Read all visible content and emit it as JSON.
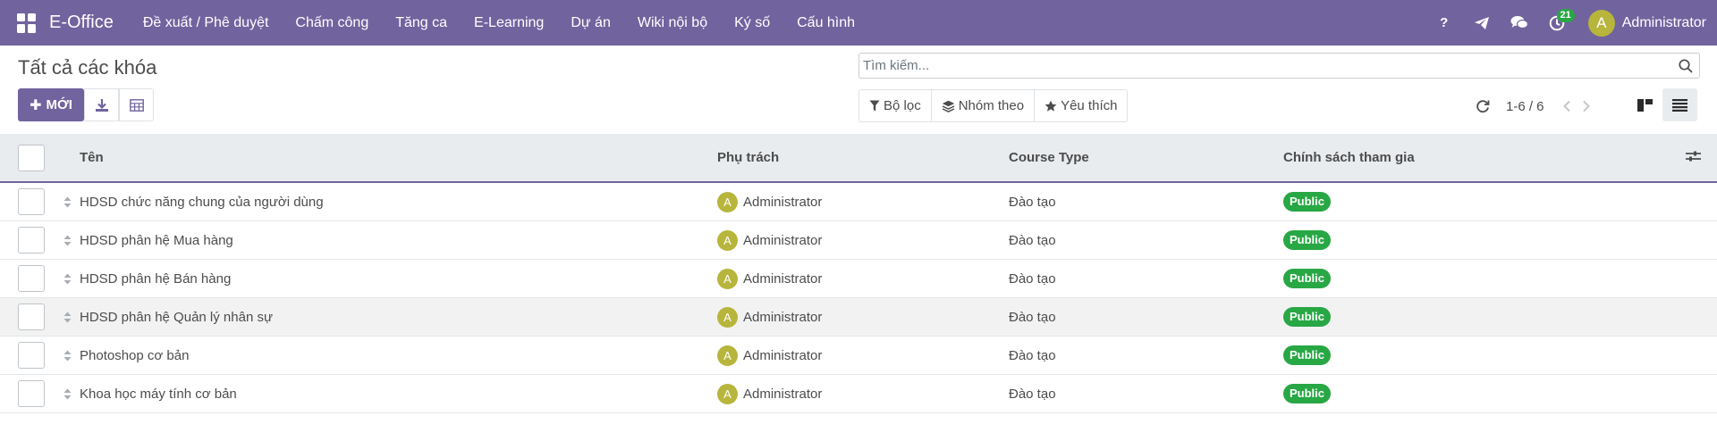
{
  "navbar": {
    "brand": "E-Office",
    "menu": [
      "Đề xuất / Phê duyệt",
      "Chấm công",
      "Tăng ca",
      "E-Learning",
      "Dự án",
      "Wiki nội bộ",
      "Ký số",
      "Cấu hình"
    ],
    "activity_count": "21",
    "help_label": "?",
    "user_initial": "A",
    "user_name": "Administrator",
    "color": "#71639e"
  },
  "control": {
    "title": "Tất cả các khóa",
    "new_label": "MỚI",
    "search_placeholder": "Tìm kiếm...",
    "filter_label": "Bộ lọc",
    "group_label": "Nhóm theo",
    "favorite_label": "Yêu thích",
    "pager": "1-6 / 6"
  },
  "table": {
    "headers": [
      "Tên",
      "Phụ trách",
      "Course Type",
      "Chính sách tham gia"
    ],
    "rows": [
      {
        "name": "HDSD chức năng chung của người dùng",
        "owner_initial": "A",
        "owner": "Administrator",
        "type": "Đào tạo",
        "policy": "Public"
      },
      {
        "name": "HDSD phân hệ Mua hàng",
        "owner_initial": "A",
        "owner": "Administrator",
        "type": "Đào tạo",
        "policy": "Public"
      },
      {
        "name": "HDSD phân hệ Bán hàng",
        "owner_initial": "A",
        "owner": "Administrator",
        "type": "Đào tạo",
        "policy": "Public"
      },
      {
        "name": "HDSD phân hệ Quản lý nhân sự",
        "owner_initial": "A",
        "owner": "Administrator",
        "type": "Đào tạo",
        "policy": "Public"
      },
      {
        "name": "Photoshop cơ bản",
        "owner_initial": "A",
        "owner": "Administrator",
        "type": "Đào tạo",
        "policy": "Public"
      },
      {
        "name": "Khoa học máy tính cơ bản",
        "owner_initial": "A",
        "owner": "Administrator",
        "type": "Đào tạo",
        "policy": "Public"
      }
    ],
    "policy_color": "#28a745"
  }
}
